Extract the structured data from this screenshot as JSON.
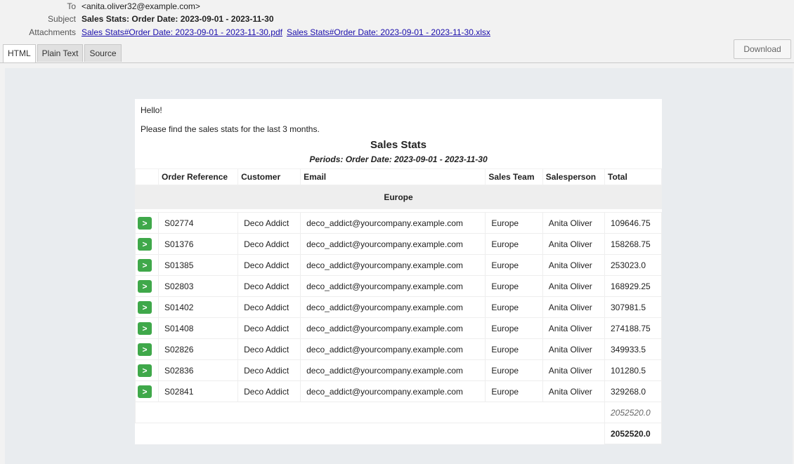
{
  "header": {
    "to_label": "To",
    "to_value": "<anita.oliver32@example.com>",
    "subject_label": "Subject",
    "subject_value": "Sales Stats: Order Date: 2023-09-01 - 2023-11-30",
    "attachments_label": "Attachments",
    "attachments": [
      "Sales Stats#Order Date: 2023-09-01 - 2023-11-30.pdf",
      "Sales Stats#Order Date: 2023-09-01 - 2023-11-30.xlsx"
    ]
  },
  "tabs": [
    "HTML",
    "Plain Text",
    "Source"
  ],
  "download_label": "Download",
  "email": {
    "greeting": "Hello!",
    "intro": "Please find the sales stats for the last 3 months.",
    "title": "Sales Stats",
    "subtitle": "Periods: Order Date: 2023-09-01 - 2023-11-30",
    "columns": [
      "Order Reference",
      "Customer",
      "Email",
      "Sales Team",
      "Salesperson",
      "Total"
    ],
    "group": "Europe",
    "row_button": ">",
    "rows": [
      {
        "ref": "S02774",
        "customer": "Deco Addict",
        "email": "deco_addict@yourcompany.example.com",
        "team": "Europe",
        "salesperson": "Anita Oliver",
        "total": "109646.75"
      },
      {
        "ref": "S01376",
        "customer": "Deco Addict",
        "email": "deco_addict@yourcompany.example.com",
        "team": "Europe",
        "salesperson": "Anita Oliver",
        "total": "158268.75"
      },
      {
        "ref": "S01385",
        "customer": "Deco Addict",
        "email": "deco_addict@yourcompany.example.com",
        "team": "Europe",
        "salesperson": "Anita Oliver",
        "total": "253023.0"
      },
      {
        "ref": "S02803",
        "customer": "Deco Addict",
        "email": "deco_addict@yourcompany.example.com",
        "team": "Europe",
        "salesperson": "Anita Oliver",
        "total": "168929.25"
      },
      {
        "ref": "S01402",
        "customer": "Deco Addict",
        "email": "deco_addict@yourcompany.example.com",
        "team": "Europe",
        "salesperson": "Anita Oliver",
        "total": "307981.5"
      },
      {
        "ref": "S01408",
        "customer": "Deco Addict",
        "email": "deco_addict@yourcompany.example.com",
        "team": "Europe",
        "salesperson": "Anita Oliver",
        "total": "274188.75"
      },
      {
        "ref": "S02826",
        "customer": "Deco Addict",
        "email": "deco_addict@yourcompany.example.com",
        "team": "Europe",
        "salesperson": "Anita Oliver",
        "total": "349933.5"
      },
      {
        "ref": "S02836",
        "customer": "Deco Addict",
        "email": "deco_addict@yourcompany.example.com",
        "team": "Europe",
        "salesperson": "Anita Oliver",
        "total": "101280.5"
      },
      {
        "ref": "S02841",
        "customer": "Deco Addict",
        "email": "deco_addict@yourcompany.example.com",
        "team": "Europe",
        "salesperson": "Anita Oliver",
        "total": "329268.0"
      }
    ],
    "group_total": "2052520.0",
    "grand_total": "2052520.0"
  },
  "colors": {
    "open_button": "#3fa84a",
    "link": "#1a0dab",
    "content_bg": "#e9ecef"
  }
}
